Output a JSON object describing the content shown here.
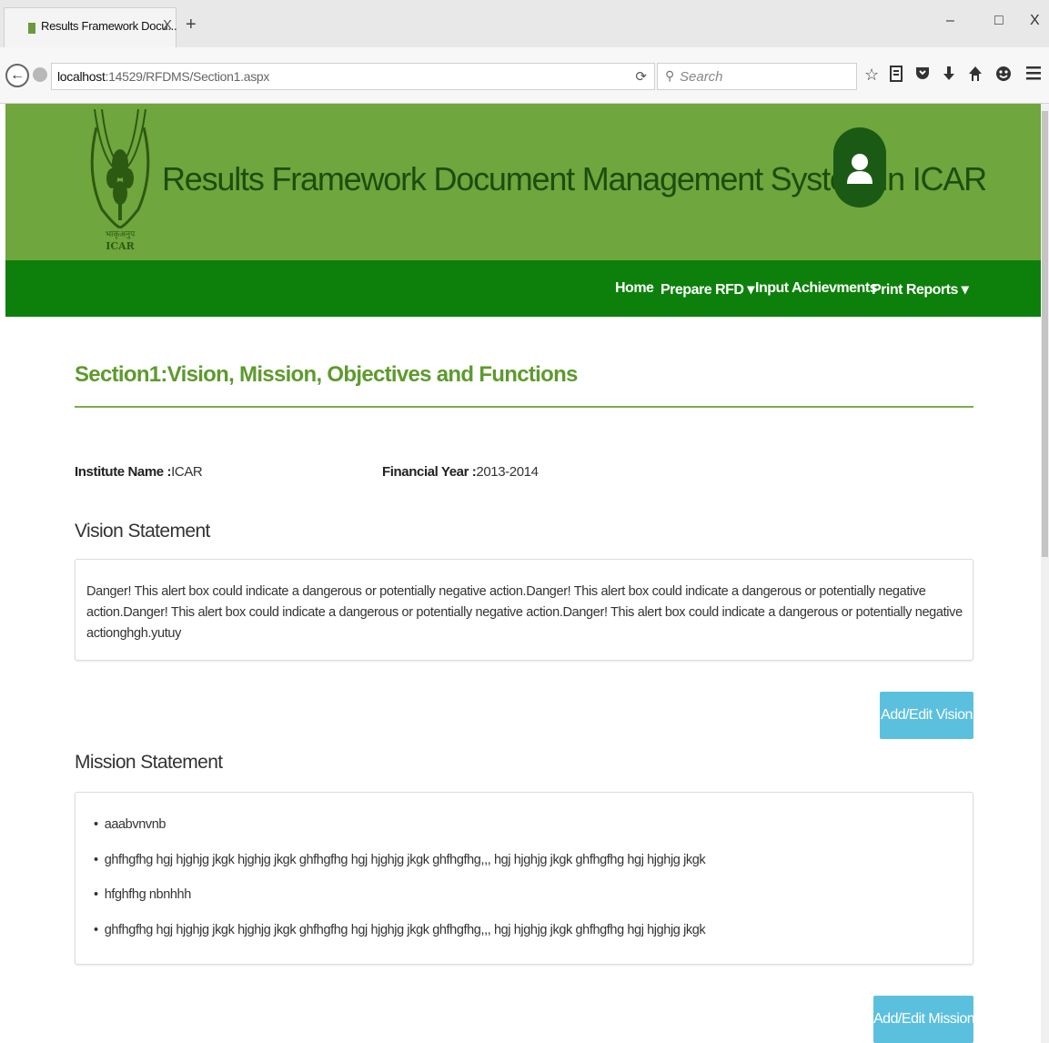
{
  "browser": {
    "tab_title": "Results Framework Docu...",
    "tab_close": "X",
    "new_tab": "+",
    "url_host": "localhost",
    "url_rest": ":14529/RFDMS/Section1.aspx",
    "search_placeholder": "Search",
    "win_minimize": "–",
    "win_restore": "□",
    "win_close": "X"
  },
  "header": {
    "title": "Results Framework Document Management System in ICAR",
    "logo_text_hindi": "भाकृअनुप",
    "logo_text": "ICAR"
  },
  "menu": {
    "home": "Home",
    "prepare_rfd": "Prepare RFD ▾",
    "input_achievements": "Input Achievments",
    "print_reports": "Print Reports ▾"
  },
  "section": {
    "title": "Section1:Vision, Mission, Objectives and Functions"
  },
  "info": {
    "institute_label": "Institute Name :",
    "institute_value": "ICAR",
    "year_label": "Financial Year :",
    "year_value": "2013-2014"
  },
  "vision": {
    "heading": "Vision Statement",
    "text": "Danger! This alert box could indicate a dangerous or potentially negative action.Danger! This alert box could indicate a dangerous or potentially negative action.Danger! This alert box could indicate a dangerous or potentially negative action.Danger! This alert box could indicate a dangerous or potentially negative actionghgh.yutuy",
    "button": "Add/Edit Vision"
  },
  "mission": {
    "heading": "Mission Statement",
    "items": [
      "aaabvnvnb",
      "ghfhgfhg hgj hjghjg jkgk hjghjg jkgk ghfhgfhg hgj hjghjg jkgk ghfhgfhg,,, hgj hjghjg jkgk ghfhgfhg hgj hjghjg jkgk",
      "hfghfhg nbnhhh",
      "ghfhgfhg hgj hjghjg jkgk hjghjg jkgk ghfhgfhg hgj hjghjg jkgk ghfhgfhg,,, hgj hjghjg jkgk ghfhgfhg hgj hjghjg jkgk"
    ],
    "button": "Add/Edit Mission"
  },
  "colors": {
    "header_green": "#6fa63d",
    "menu_green": "#0d800b",
    "title_green": "#5e9a2e",
    "button_blue": "#5bc0de"
  }
}
